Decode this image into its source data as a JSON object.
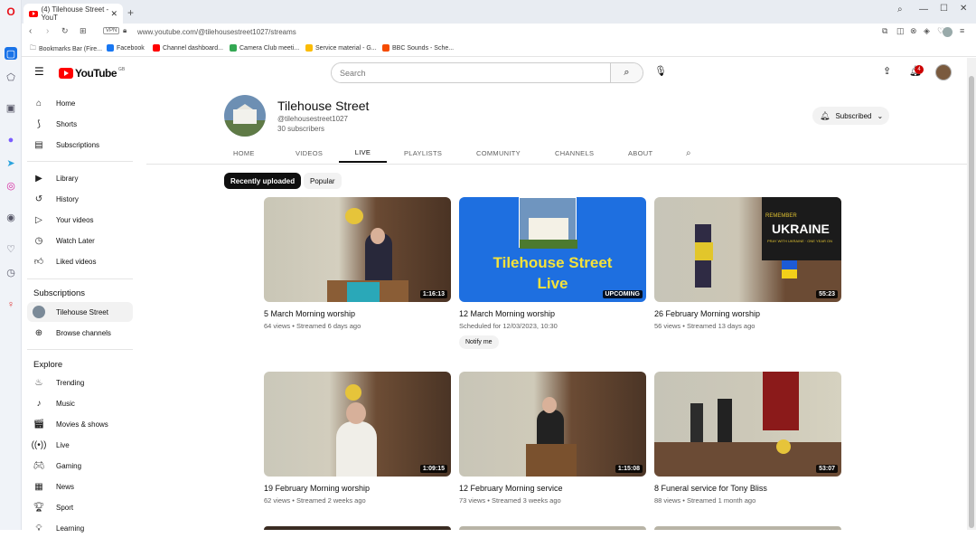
{
  "browser": {
    "tab_title": "(4) Tilehouse Street - YouT",
    "url": "www.youtube.com/@tilehousestreet1027/streams",
    "vpn": "VPN",
    "bookmarks": [
      "Bookmarks Bar (Fire...",
      "Facebook",
      "Channel dashboard...",
      "Camera Club meeti...",
      "Service material - G...",
      "BBC Sounds - Sche..."
    ]
  },
  "header": {
    "logo": "YouTube",
    "region": "GB",
    "search_placeholder": "Search",
    "notif_count": "4"
  },
  "sidebar": {
    "main": [
      {
        "label": "Home",
        "icon": "home-icon"
      },
      {
        "label": "Shorts",
        "icon": "shorts-icon"
      },
      {
        "label": "Subscriptions",
        "icon": "subscriptions-icon"
      }
    ],
    "library": [
      {
        "label": "Library",
        "icon": "library-icon"
      },
      {
        "label": "History",
        "icon": "history-icon"
      },
      {
        "label": "Your videos",
        "icon": "your-videos-icon"
      },
      {
        "label": "Watch Later",
        "icon": "watch-later-icon"
      },
      {
        "label": "Liked videos",
        "icon": "liked-icon"
      }
    ],
    "subs_title": "Subscriptions",
    "subs": [
      {
        "label": "Tilehouse Street"
      },
      {
        "label": "Browse channels"
      }
    ],
    "explore_title": "Explore",
    "explore": [
      {
        "label": "Trending",
        "icon": "trending-icon"
      },
      {
        "label": "Music",
        "icon": "music-icon"
      },
      {
        "label": "Movies & shows",
        "icon": "movies-icon"
      },
      {
        "label": "Live",
        "icon": "live-icon"
      },
      {
        "label": "Gaming",
        "icon": "gaming-icon"
      },
      {
        "label": "News",
        "icon": "news-icon"
      },
      {
        "label": "Sport",
        "icon": "sport-icon"
      },
      {
        "label": "Learning",
        "icon": "learning-icon"
      }
    ]
  },
  "channel": {
    "name": "Tilehouse Street",
    "handle": "@tilehousestreet1027",
    "subscribers": "30 subscribers",
    "subscribed_label": "Subscribed",
    "tabs": [
      "HOME",
      "VIDEOS",
      "LIVE",
      "PLAYLISTS",
      "COMMUNITY",
      "CHANNELS",
      "ABOUT"
    ],
    "chips": [
      "Recently uploaded",
      "Popular"
    ]
  },
  "videos": [
    {
      "title": "5 March Morning worship",
      "meta": "64 views • Streamed 6 days ago",
      "duration": "1:16:13"
    },
    {
      "title": "12 March Morning worship",
      "meta": "Scheduled for 12/03/2023, 10:30",
      "duration": "UPCOMING",
      "thumb_text1": "Tilehouse Street",
      "thumb_text2": "Live",
      "notify": "Notify me"
    },
    {
      "title": "26 February Morning worship",
      "meta": "56 views • Streamed 13 days ago",
      "duration": "55:23",
      "banner": "UKRAINE",
      "banner_top": "REMEMBER",
      "banner_sub": "PRAY WITH UKRAINE · ONE YEAR ON"
    },
    {
      "title": "19 February Morning worship",
      "meta": "62 views • Streamed 2 weeks ago",
      "duration": "1:09:15"
    },
    {
      "title": "12 February Morning service",
      "meta": "73 views • Streamed 3 weeks ago",
      "duration": "1:15:08"
    },
    {
      "title": "8 Funeral service for Tony Bliss",
      "meta": "88 views • Streamed 1 month ago",
      "duration": "53:07"
    }
  ]
}
